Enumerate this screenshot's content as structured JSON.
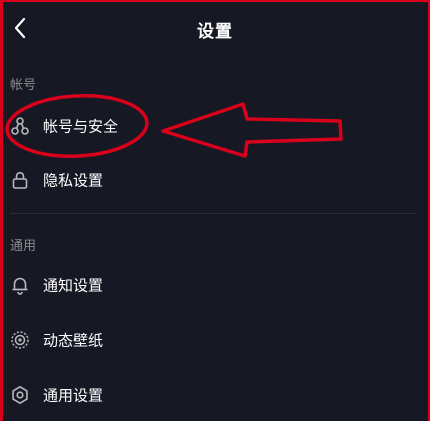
{
  "header": {
    "title": "设置",
    "back_icon": "chevron-left-icon"
  },
  "sections": [
    {
      "label": "帐号",
      "items": [
        {
          "label": "帐号与安全",
          "icon": "account-link-icon"
        },
        {
          "label": "隐私设置",
          "icon": "lock-icon"
        }
      ]
    },
    {
      "label": "通用",
      "items": [
        {
          "label": "通知设置",
          "icon": "bell-icon"
        },
        {
          "label": "动态壁纸",
          "icon": "live-wallpaper-icon"
        },
        {
          "label": "通用设置",
          "icon": "gear-icon"
        }
      ]
    }
  ],
  "annotation": {
    "highlight": "帐号与安全",
    "color": "#d9001b"
  },
  "colors": {
    "background": "#161823",
    "text": "#ffffff",
    "section_label": "#8a8b91",
    "icon": "#b8b9bd"
  }
}
